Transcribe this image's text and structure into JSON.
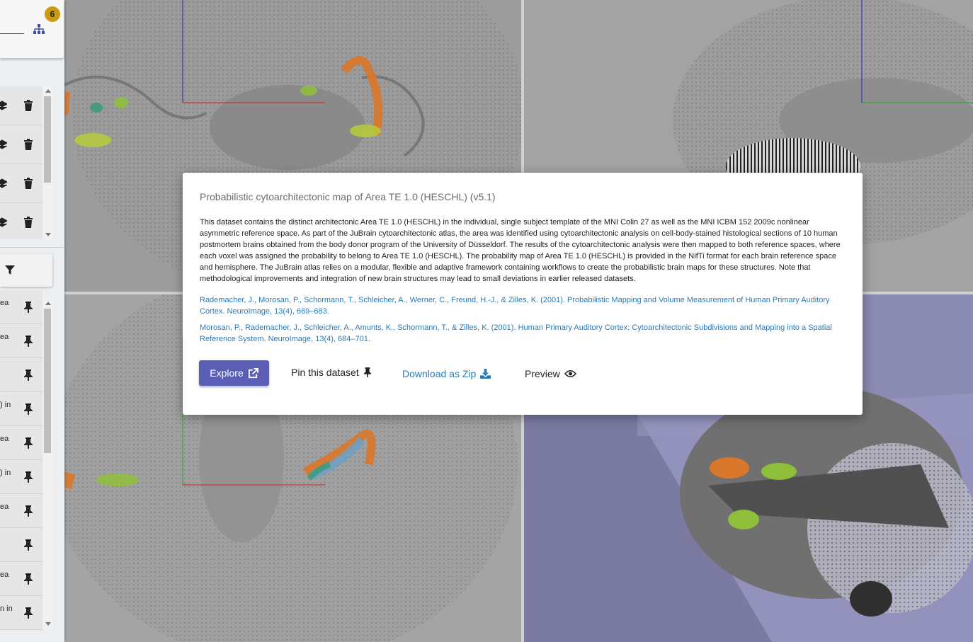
{
  "sidebar": {
    "badge_count": "6",
    "selected_rows": 4,
    "dataset_rows": [
      {
        "text": "ea"
      },
      {
        "text": "ea"
      },
      {
        "text": ""
      },
      {
        "text": ") in"
      },
      {
        "text": "ea"
      },
      {
        "text": ") in"
      },
      {
        "text": "ea"
      },
      {
        "text": ""
      },
      {
        "text": "ea"
      },
      {
        "text": "n in"
      }
    ]
  },
  "modal": {
    "title": "Probabilistic cytoarchitectonic map of Area TE 1.0 (HESCHL) (v5.1)",
    "description": "This dataset contains the distinct architectonic Area TE 1.0 (HESCHL) in the individual, single subject template of the MNI Colin 27 as well as the MNI ICBM 152 2009c nonlinear asymmetric reference space. As part of the JuBrain cytoarchitectonic atlas, the area was identified using cytoarchitectonic analysis on cell-body-stained histological sections of 10 human postmortem brains obtained from the body donor program of the University of Düsseldorf. The results of the cytoarchitectonic analysis were then mapped to both reference spaces, where each voxel was assigned the probability to belong to Area TE 1.0 (HESCHL). The probability map of Area TE 1.0 (HESCHL) is provided in the NifTi format for each brain reference space and hemisphere. The JuBrain atlas relies on a modular, flexible and adaptive framework containing workflows to create the probabilistic brain maps for these structures. Note that methodological improvements and integration of new brain structures may lead to small deviations in earlier released datasets.",
    "references": [
      "Rademacher, J., Morosan, P., Schormann, T., Schleicher, A., Werner, C., Freund, H.-J., & Zilles, K. (2001). Probabilistic Mapping and Volume Measurement of Human Primary Auditory Cortex. NeuroImage, 13(4), 669–683.",
      "Morosan, P., Rademacher, J., Schleicher, A., Amunts, K., Schormann, T., & Zilles, K. (2001). Human Primary Auditory Cortex: Cytoarchitectonic Subdivisions and Mapping into a Spatial Reference System. NeuroImage, 13(4), 684–701."
    ],
    "buttons": {
      "explore": "Explore",
      "pin": "Pin this dataset",
      "download": "Download as Zip",
      "preview": "Preview"
    }
  },
  "colors": {
    "accent": "#5b5eb5",
    "link": "#2a7ab5",
    "badge": "#c99a12",
    "region_orange": "#d9772a",
    "region_green": "#8fbf3a",
    "region_teal": "#3a9a7a",
    "region_blue": "#6aa0c8"
  },
  "icons": {
    "tree": "sitemap-icon",
    "layer": "layers-icon",
    "delete": "trash-icon",
    "filter": "filter-icon",
    "pin": "pin-icon",
    "external": "external-link-icon",
    "download": "download-icon",
    "preview": "eye-icon"
  }
}
